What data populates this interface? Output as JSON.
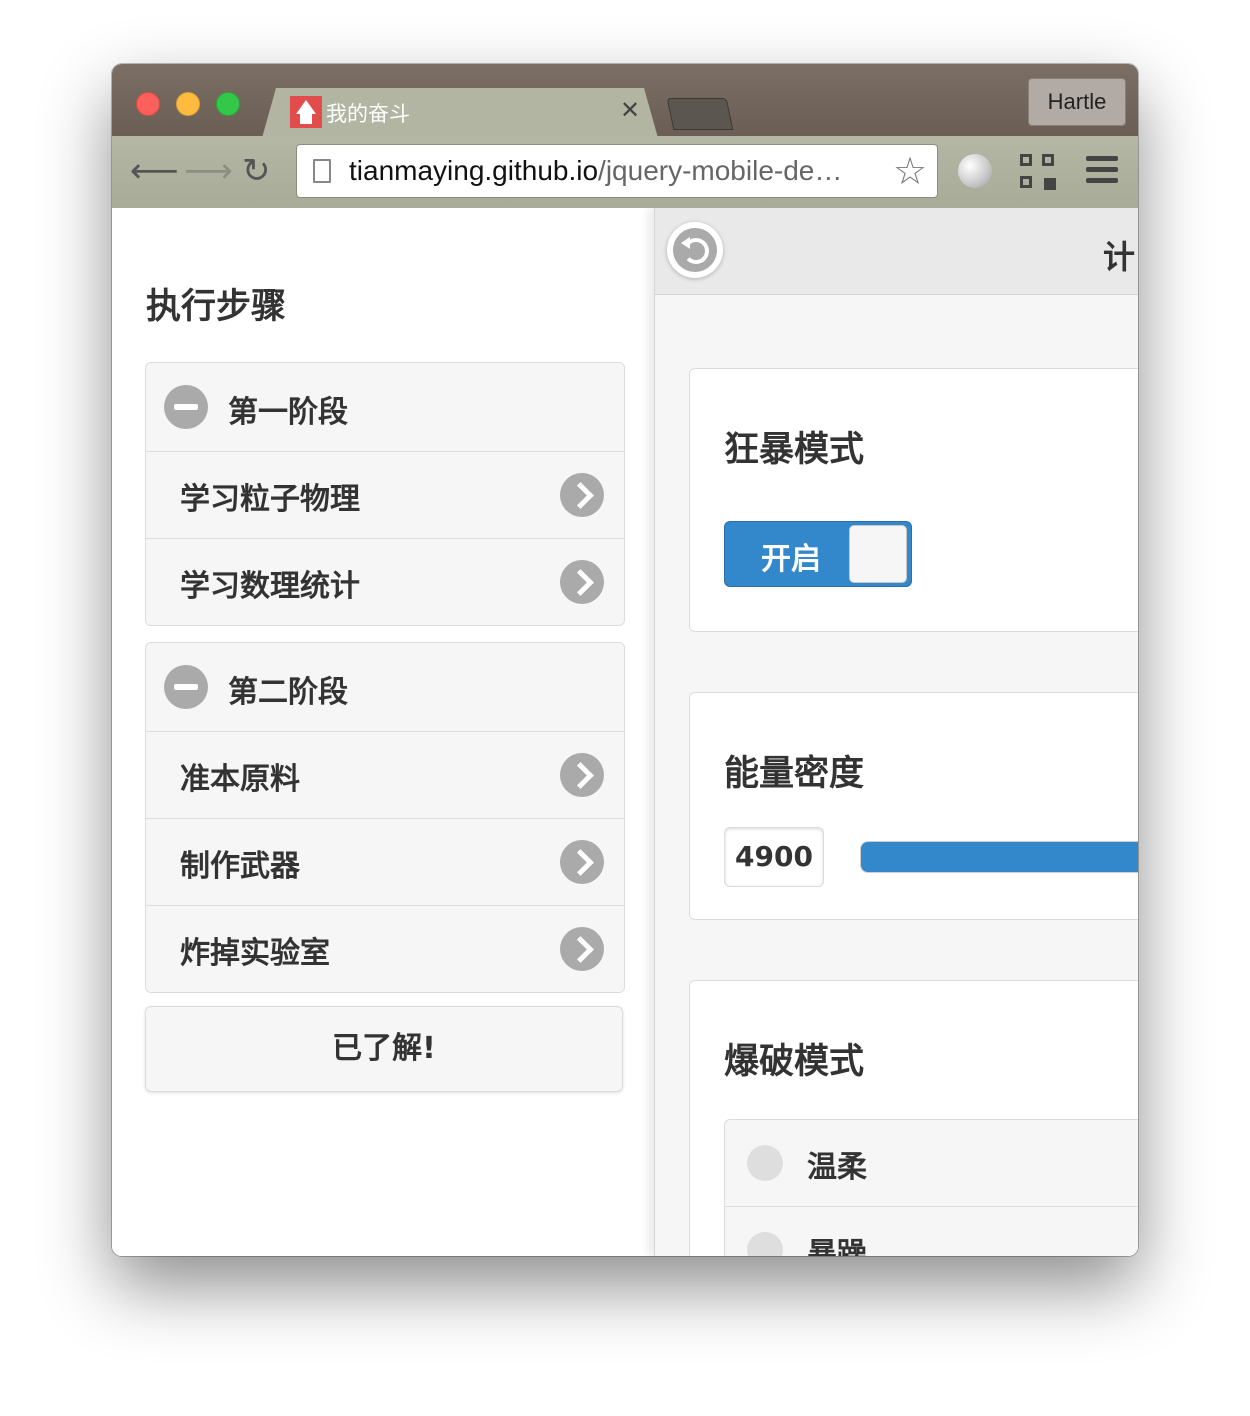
{
  "browser": {
    "tab_title": "我的奋斗",
    "profile_name": "Hartle",
    "url_host": "tianmaying.github.io",
    "url_rest": "/jquery-mobile-de…"
  },
  "left_panel": {
    "title": "执行步骤",
    "stage1": {
      "title": "第一阶段",
      "items": [
        "学习粒子物理",
        "学习数理统计"
      ]
    },
    "stage2": {
      "title": "第二阶段",
      "items": [
        "准本原料",
        "制作武器",
        "炸掉实验室"
      ]
    },
    "ok_button": "已了解!"
  },
  "right_panel": {
    "header_title": "计",
    "berserk": {
      "title": "狂暴模式",
      "switch_label": "开启",
      "switch_on": true
    },
    "energy": {
      "title": "能量密度",
      "value": "4900"
    },
    "blast": {
      "title": "爆破模式",
      "options": [
        "温柔",
        "暴躁"
      ]
    }
  },
  "colors": {
    "accent": "#3388cc",
    "titlebar": "#6e6159",
    "toolbar": "#aeb19d"
  },
  "icons": {
    "minus": "minus-icon",
    "arrow": "chevron-right-icon",
    "back": "back-icon"
  }
}
